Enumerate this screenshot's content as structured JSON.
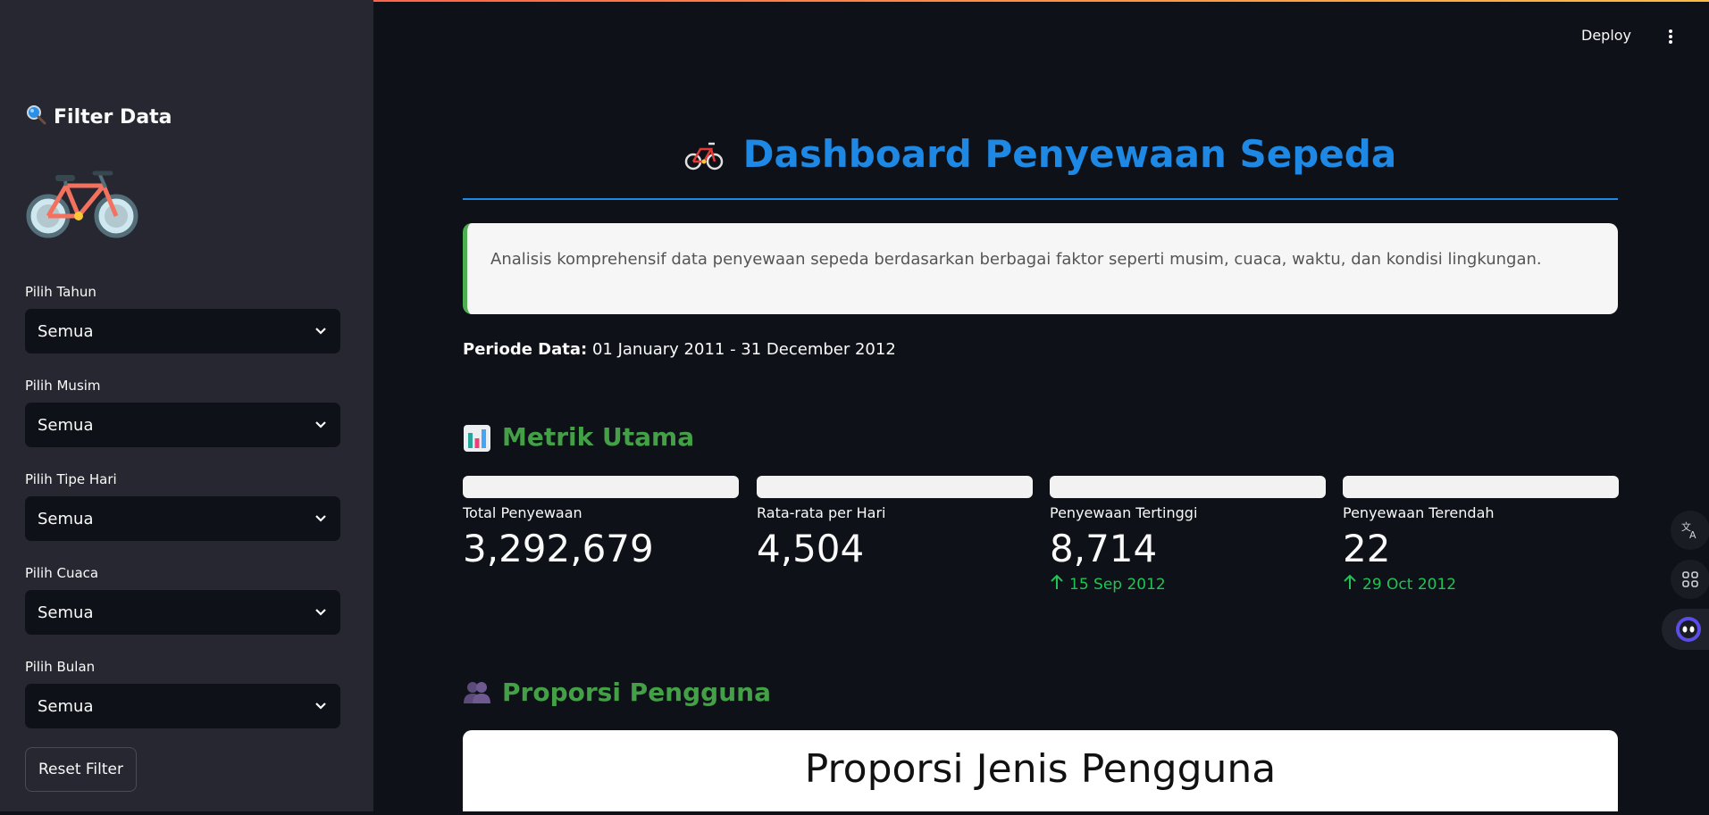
{
  "header": {
    "deploy_label": "Deploy"
  },
  "sidebar": {
    "title": "Filter Data",
    "title_icon": "magnifier-icon",
    "filters": [
      {
        "label": "Pilih Tahun",
        "value": "Semua"
      },
      {
        "label": "Pilih Musim",
        "value": "Semua"
      },
      {
        "label": "Pilih Tipe Hari",
        "value": "Semua"
      },
      {
        "label": "Pilih Cuaca",
        "value": "Semua"
      },
      {
        "label": "Pilih Bulan",
        "value": "Semua"
      }
    ],
    "reset_label": "Reset Filter"
  },
  "main": {
    "title": "Dashboard Penyewaan Sepeda",
    "description": "Analisis komprehensif data penyewaan sepeda berdasarkan berbagai faktor seperti musim, cuaca, waktu, dan kondisi lingkungan.",
    "periode_label": "Periode Data:",
    "periode_value": "01 January 2011 - 31 December 2012",
    "metrics_title": "Metrik Utama",
    "metrics": [
      {
        "label": "Total Penyewaan",
        "value": "3,292,679",
        "delta": ""
      },
      {
        "label": "Rata-rata per Hari",
        "value": "4,504",
        "delta": ""
      },
      {
        "label": "Penyewaan Tertinggi",
        "value": "8,714",
        "delta": "15 Sep 2012"
      },
      {
        "label": "Penyewaan Terendah",
        "value": "22",
        "delta": "29 Oct 2012"
      }
    ],
    "users_title": "Proporsi Pengguna",
    "chart_title": "Proporsi Jenis Pengguna"
  },
  "colors": {
    "accent_blue": "#1e88e5",
    "section_green": "#43a047",
    "delta_green": "#21c354",
    "sidebar_bg": "#262730",
    "app_bg": "#0e1117"
  }
}
